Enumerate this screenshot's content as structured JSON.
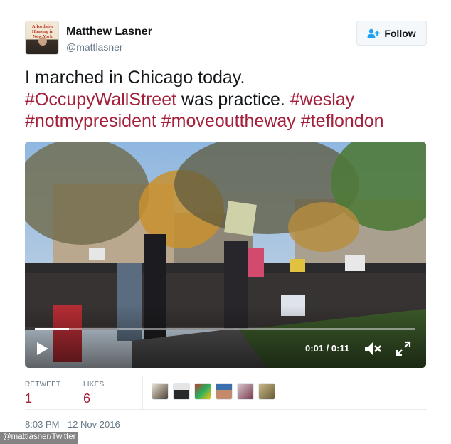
{
  "author": {
    "name": "Matthew Lasner",
    "handle": "@mattlasner",
    "avatar_text": "Affordable Housing in New York"
  },
  "follow": {
    "label": "Follow",
    "icon": "add-user-icon"
  },
  "tweet": {
    "line1": "I marched in Chicago today.",
    "hashtag1": "#OccupyWallStreet",
    "line2_mid": " was practice. ",
    "hashtag2": "#weslay",
    "hashtag3": "#notmypresident",
    "hashtag4": "#moveouttheway",
    "hashtag5": "#teflondon"
  },
  "video": {
    "time": "0:01 / 0:11",
    "progress_fraction": 0.09,
    "play_icon": "play-icon",
    "mute_icon": "mute-icon",
    "fullscreen_icon": "fullscreen-icon"
  },
  "stats": {
    "retweet_label": "RETWEET",
    "retweet_count": "1",
    "likes_label": "LIKES",
    "likes_count": "6",
    "liker_avatar_count": 6
  },
  "timestamp": "8:03 PM - 12 Nov 2016",
  "credit": "@mattlasner/Twitter",
  "colors": {
    "hashtag": "#a5203a",
    "text": "#14171a",
    "muted": "#657786",
    "border": "#e6ecf0"
  }
}
